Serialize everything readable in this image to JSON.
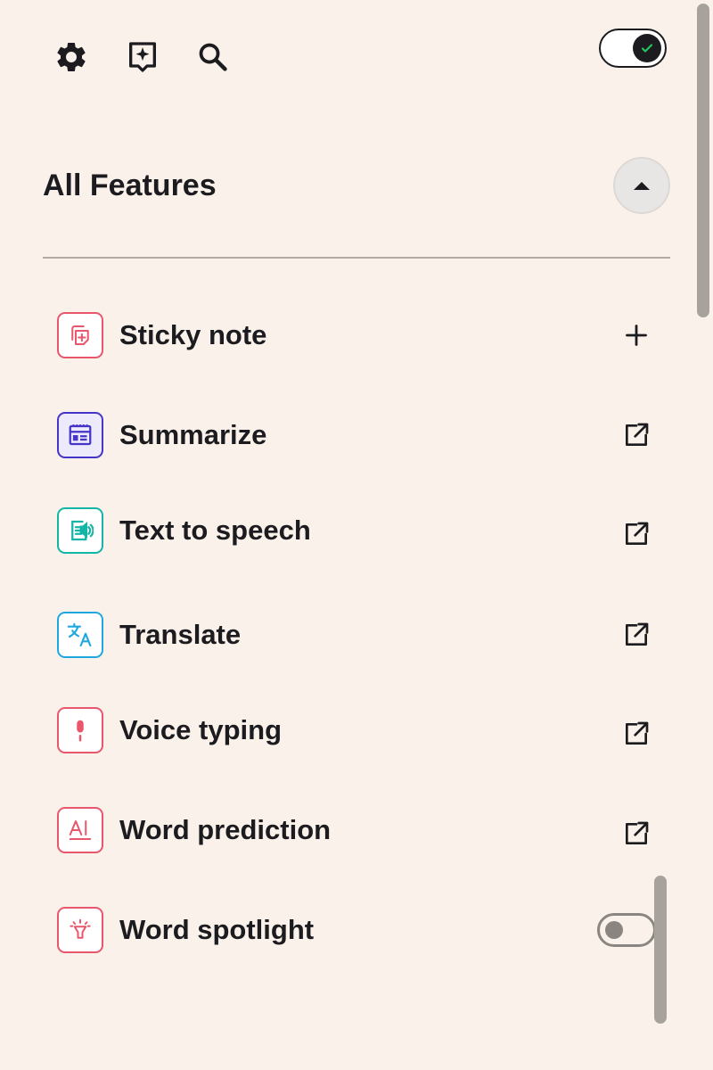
{
  "topbar": {
    "icons": [
      "gear-icon",
      "sparkle-note-icon",
      "search-icon"
    ],
    "master_toggle": {
      "on": true
    }
  },
  "section": {
    "title": "All Features",
    "expanded": true
  },
  "features": [
    {
      "label": "Sticky note",
      "icon": "sticky-note-icon",
      "color": "#E8576B",
      "action": "add"
    },
    {
      "label": "Summarize",
      "icon": "summarize-icon",
      "color": "#4535C9",
      "action": "open-external"
    },
    {
      "label": "Text to speech",
      "icon": "text-to-speech-icon",
      "color": "#12B5A6",
      "action": "open-external"
    },
    {
      "label": "Translate",
      "icon": "translate-icon",
      "color": "#1FA8E0",
      "action": "open-external"
    },
    {
      "label": "Voice typing",
      "icon": "microphone-icon",
      "color": "#E8576B",
      "action": "open-external"
    },
    {
      "label": "Word prediction",
      "icon": "word-prediction-icon",
      "color": "#E8576B",
      "action": "open-external"
    },
    {
      "label": "Word spotlight",
      "icon": "spotlight-icon",
      "color": "#E8576B",
      "action": "toggle",
      "toggle_on": false
    }
  ],
  "colors": {
    "background": "#FAF2EA",
    "text": "#1C1B1F",
    "toggle_check": "#22C55E"
  }
}
